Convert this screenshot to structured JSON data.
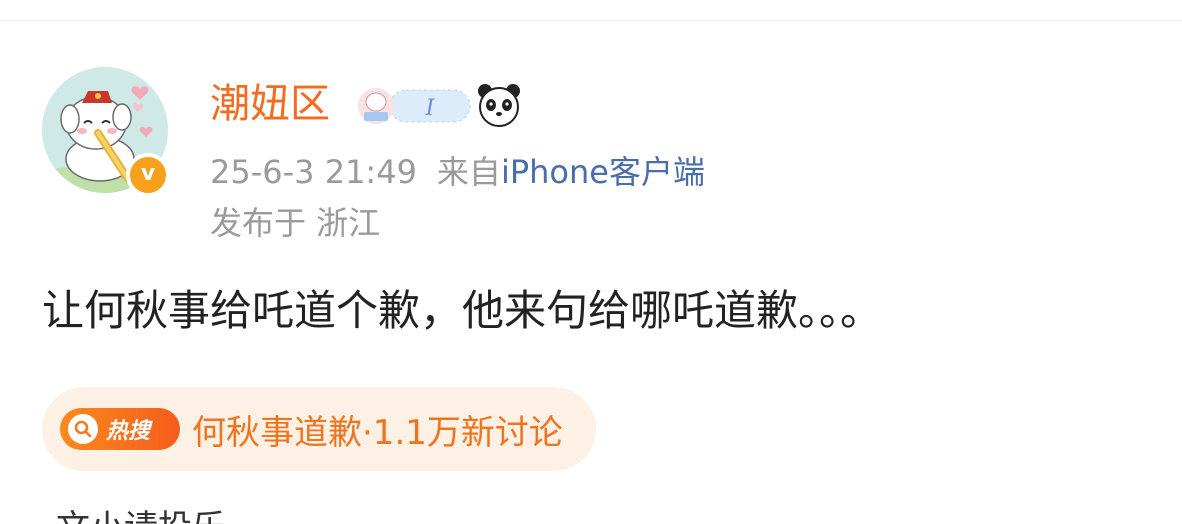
{
  "post": {
    "author": {
      "name": "潮妞区",
      "verified_mark": "v",
      "member_badge_text": "I"
    },
    "meta": {
      "time": "25-6-3 21:49",
      "from_label": "来自",
      "client": "iPhone客户端",
      "location": "发布于 浙江"
    },
    "body": "让何秋事给吒道个歉，他来句给哪吒道歉。。。",
    "hot_topic": {
      "tag_label": "热搜",
      "text": "何秋事道歉·1.1万新讨论"
    },
    "cutoff_text": "文小请投乐"
  },
  "colors": {
    "username": "#f26b1f",
    "meta_gray": "#9a9a9a",
    "client_link": "#4a6ea9",
    "hot_orange": "#f0741d",
    "hot_bg": "#fdf1e6",
    "verified": "#f7a01a"
  },
  "icons": {
    "avatar": "cartoon-dog-avatar",
    "verified": "verified-v-icon",
    "member": "member-badge-icon",
    "panda": "panda-icon",
    "search": "search-icon"
  }
}
